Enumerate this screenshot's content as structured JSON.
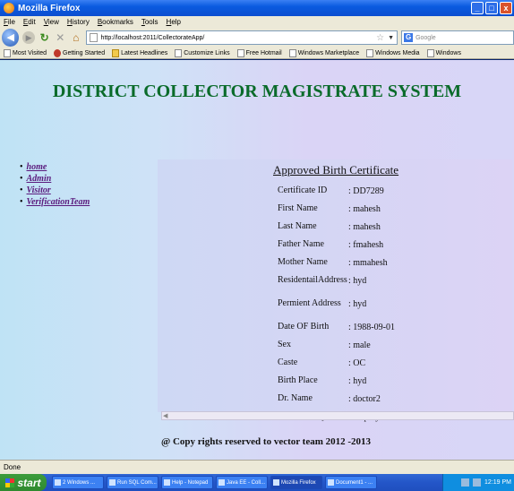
{
  "window": {
    "title": "Mozilla Firefox",
    "buttons": [
      "_",
      "□",
      "x"
    ]
  },
  "menu": [
    "File",
    "Edit",
    "View",
    "History",
    "Bookmarks",
    "Tools",
    "Help"
  ],
  "nav": {
    "back_icon": "back-arrow-icon",
    "url": "http://localhost:2011/CollectorateApp/",
    "search_placeholder": "Google"
  },
  "bookmarks": [
    "Most Visited",
    "Getting Started",
    "Latest Headlines",
    "Customize Links",
    "Free Hotmail",
    "Windows Marketplace",
    "Windows Media",
    "Windows"
  ],
  "page": {
    "heading": "DISTRICT COLLECTOR MAGISTRATE SYSTEM",
    "sidenav": [
      "home",
      "Admin",
      "Visitor",
      "VerificationTeam"
    ],
    "cert_title": "Approved Birth Certificate",
    "rows": [
      {
        "label": "Certificate ID",
        "value": ": DD7289"
      },
      {
        "label": "First Name",
        "value": ": mahesh"
      },
      {
        "label": "Last Name",
        "value": ": mahesh"
      },
      {
        "label": "Father Name",
        "value": ": fmahesh"
      },
      {
        "label": "Mother Name",
        "value": ": mmahesh"
      },
      {
        "label": "ResidentailAddress",
        "value": ": hyd"
      },
      {
        "label": "Permient Address",
        "value": ": hyd"
      },
      {
        "label": "Date OF Birth",
        "value": ": 1988-09-01"
      },
      {
        "label": "Sex",
        "value": ": male"
      },
      {
        "label": "Caste",
        "value": ": OC"
      },
      {
        "label": "Birth Place",
        "value": ": hyd"
      },
      {
        "label": "Dr. Name",
        "value": ": doctor2"
      },
      {
        "label": "Father Occupation",
        "value": ": employee"
      }
    ],
    "footer": "@ Copy rights reserved to vector team 2012 -2013"
  },
  "status": "Done",
  "taskbar": {
    "start": "start",
    "tasks": [
      "2 Windows ...",
      "Run SQL Com...",
      "Help - Notepad",
      "Java EE - Coll...",
      "Mozilla Firefox",
      "Document1 - ..."
    ],
    "clock": "12:19 PM"
  },
  "colors": {
    "heading": "#0a6b2a",
    "link": "#5a1a7d",
    "titlebar": "#0a5be0"
  }
}
